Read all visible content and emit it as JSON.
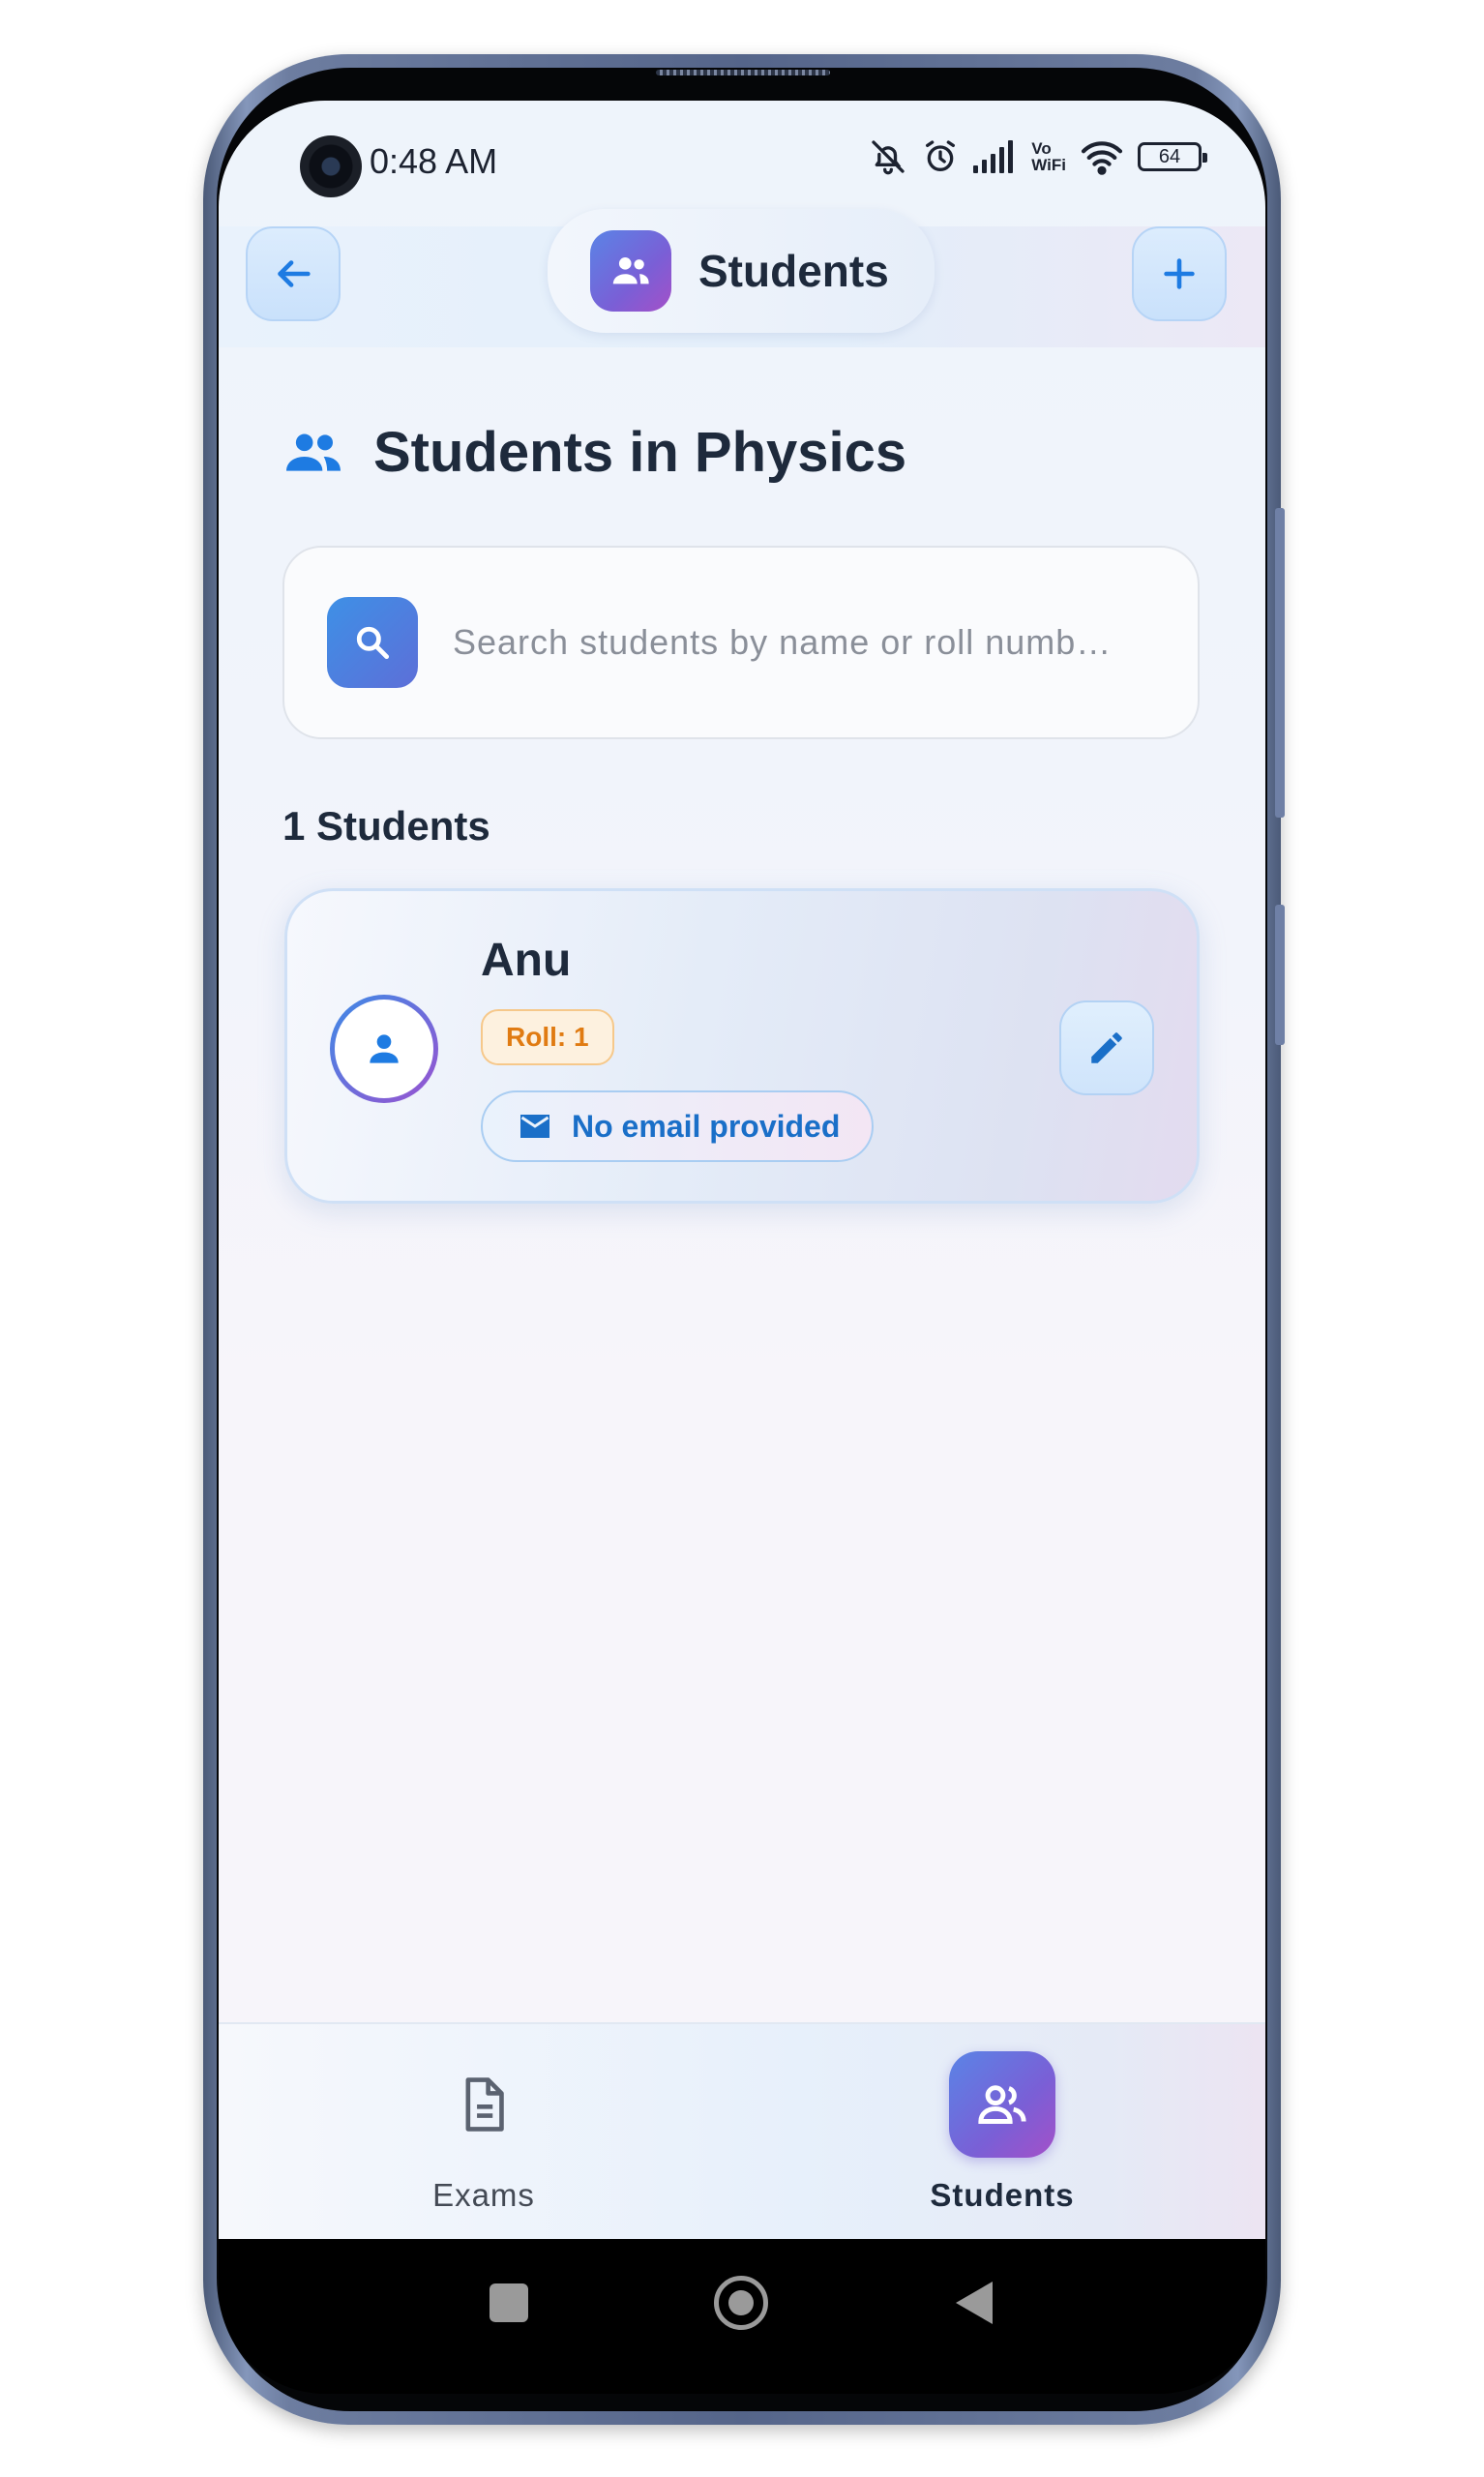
{
  "status_bar": {
    "time": "0:48 AM",
    "battery": "64",
    "vowifi_top": "Vo",
    "vowifi_bottom": "WiFi",
    "icons": [
      "bell-off-icon",
      "alarm-icon",
      "signal-icon",
      "vowifi-icon",
      "wifi-icon",
      "battery-icon"
    ]
  },
  "app_bar": {
    "title": "Students",
    "back_icon": "arrow-left-icon",
    "add_icon": "plus-icon",
    "title_icon": "group-icon"
  },
  "page": {
    "heading": "Students in Physics",
    "heading_icon": "group-icon"
  },
  "search": {
    "placeholder": "Search students by name or roll numb…",
    "value": ""
  },
  "list": {
    "count_label": "1 Students",
    "students": [
      {
        "name": "Anu",
        "roll": "Roll: 1",
        "email": "No email provided"
      }
    ]
  },
  "bottom_nav": {
    "items": [
      {
        "label": "Exams",
        "icon": "document-icon",
        "active": false
      },
      {
        "label": "Students",
        "icon": "group-icon",
        "active": true
      }
    ]
  },
  "colors": {
    "accent": "#1e7be2",
    "gradient_start": "#5a84e6",
    "gradient_end": "#a450c8",
    "roll_badge": "#e07b12",
    "text_primary": "#1e2a3c"
  }
}
